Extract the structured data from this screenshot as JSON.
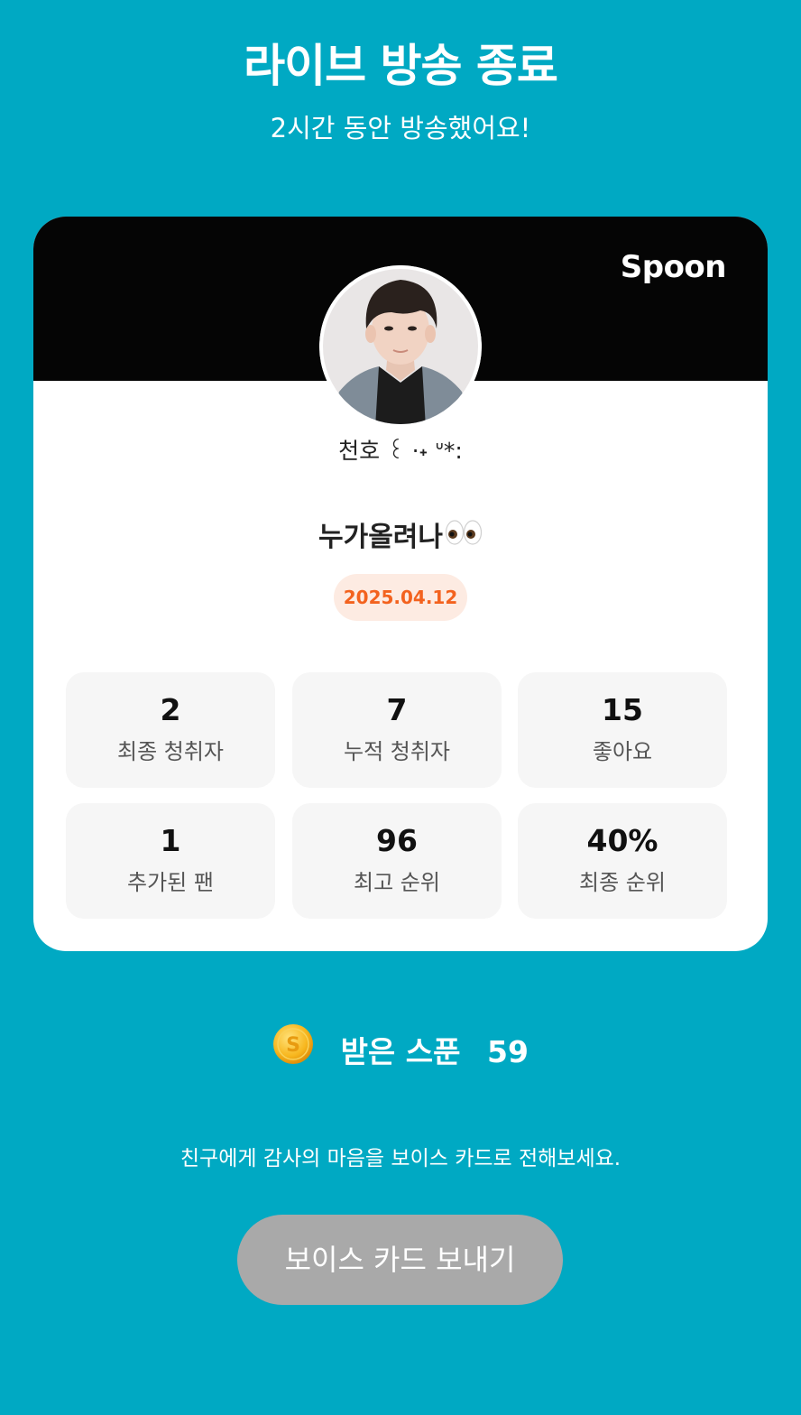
{
  "header": {
    "title": "라이브 방송 종료",
    "subtitle": "2시간 동안 방송했어요!"
  },
  "card": {
    "brand": "Spoon",
    "nickname": "천호 ꒰ ·˖ ᐡ*:",
    "live_title": "누가올려나",
    "live_title_emoji": "eyes-emoji",
    "date": "2025.04.12",
    "stats": [
      {
        "value": "2",
        "label": "최종 청취자"
      },
      {
        "value": "7",
        "label": "누적 청취자"
      },
      {
        "value": "15",
        "label": "좋아요"
      },
      {
        "value": "1",
        "label": "추가된 팬"
      },
      {
        "value": "96",
        "label": "최고 순위"
      },
      {
        "value": "40%",
        "label": "최종 순위"
      }
    ]
  },
  "spoons": {
    "label": "받은 스푼",
    "count": "59",
    "icon": "spoon-coin-icon"
  },
  "footer": {
    "message": "친구에게 감사의 마음을 보이스 카드로 전해보세요.",
    "button_label": "보이스 카드 보내기"
  },
  "colors": {
    "background": "#00a9c3",
    "date_badge_text": "#f3621e",
    "date_badge_bg": "#fdebe2",
    "button_bg": "#a9a9a9"
  }
}
